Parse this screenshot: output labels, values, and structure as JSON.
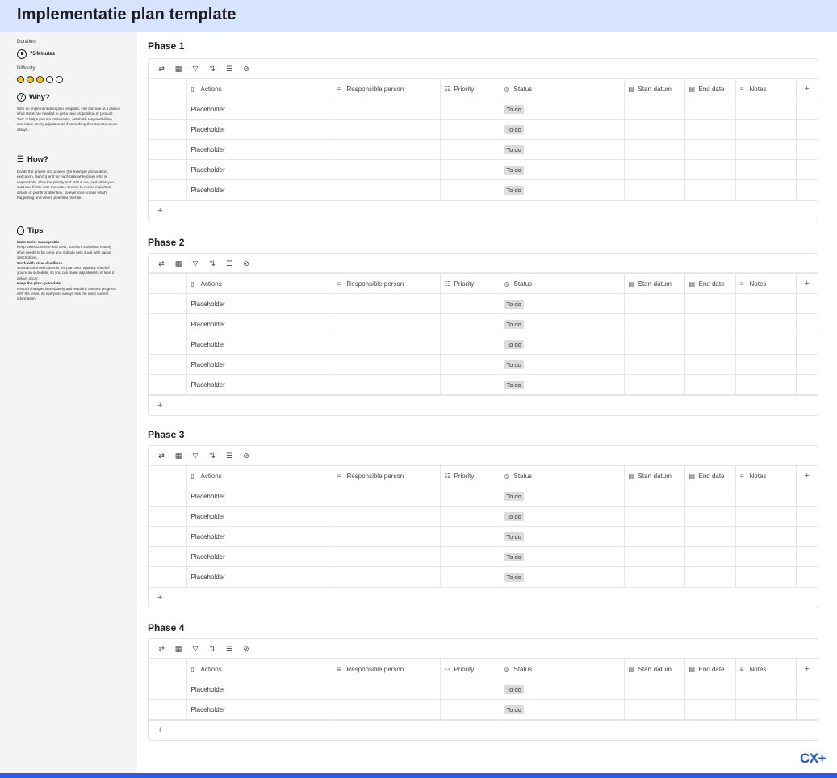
{
  "page": {
    "title": "Implementatie plan template"
  },
  "sidebar": {
    "duration_label": "Duration",
    "duration_value": "75 Minutes",
    "difficulty_label": "Difficulty",
    "difficulty_level": 3,
    "difficulty_max": 5,
    "why_title": "Why?",
    "why_text": "With an implementation plan template, you can see at a glance what steps are needed to get a new proposition or product 'live'. It helps you structure tasks, establish responsibilities, and make timely adjustments if something threatens to cause delays.",
    "how_title": "How?",
    "how_text": "Divide the project into phases (for example preparation, execution, launch) and for each task write down who is responsible, what the priority and status are, and when you start and finish. Use the notes section to record important details or points of attention, so everyone knows what's happening and where potential risks lie.",
    "tips_title": "Tips",
    "tips": [
      {
        "title": "Make tasks manageable",
        "text": "Keep tasks concrete and clear, so that it's obvious exactly what needs to be done and nobody gets stuck with vague descriptions."
      },
      {
        "title": "Work with clear deadlines",
        "text": "Set start and end dates in the plan and regularly check if you're on schedule, so you can make adjustments in time if delays occur."
      },
      {
        "title": "Keep the plan up-to-date",
        "text": "Record changes immediately and regularly discuss progress with the team, so everyone always has the most current information."
      }
    ]
  },
  "columns": [
    "Actions",
    "Responsible person",
    "Priority",
    "Status",
    "Start datum",
    "End date",
    "Notes"
  ],
  "phases": [
    {
      "title": "Phase 1",
      "rows": [
        {
          "action": "Placeholder",
          "status": "To do"
        },
        {
          "action": "Placeholder",
          "status": "To do"
        },
        {
          "action": "Placeholder",
          "status": "To do"
        },
        {
          "action": "Placeholder",
          "status": "To do"
        },
        {
          "action": "Placeholder",
          "status": "To do"
        }
      ]
    },
    {
      "title": "Phase 2",
      "rows": [
        {
          "action": "Placeholder",
          "status": "To do"
        },
        {
          "action": "Placeholder",
          "status": "To do"
        },
        {
          "action": "Placeholder",
          "status": "To do"
        },
        {
          "action": "Placeholder",
          "status": "To do"
        },
        {
          "action": "Placeholder",
          "status": "To do"
        }
      ]
    },
    {
      "title": "Phase 3",
      "rows": [
        {
          "action": "Placeholder",
          "status": "To do"
        },
        {
          "action": "Placeholder",
          "status": "To do"
        },
        {
          "action": "Placeholder",
          "status": "To do"
        },
        {
          "action": "Placeholder",
          "status": "To do"
        },
        {
          "action": "Placeholder",
          "status": "To do"
        }
      ]
    },
    {
      "title": "Phase 4",
      "rows": [
        {
          "action": "Placeholder",
          "status": "To do"
        },
        {
          "action": "Placeholder",
          "status": "To do"
        }
      ]
    }
  ],
  "toolbar_icons": [
    "sync-icon",
    "layout-icon",
    "filter-icon",
    "sort-icon",
    "group-icon",
    "hide-fields-icon"
  ],
  "column_icons": [
    "bookmark-icon",
    "text-lines-icon",
    "list-icon",
    "status-circle-icon",
    "calendar-icon",
    "calendar-icon",
    "text-lines-icon"
  ],
  "add_symbol": "+",
  "brand": {
    "logo_text": "CX+",
    "accent": "#2e5ae6",
    "header_bg": "#d6e4ff",
    "difficulty_color": "#f5c518"
  }
}
